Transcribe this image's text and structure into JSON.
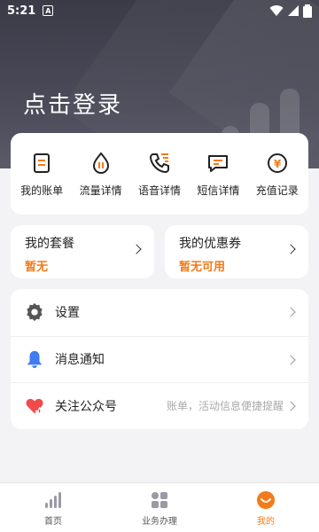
{
  "status_bar": {
    "time": "5:21",
    "notification_letter": "A"
  },
  "header": {
    "login_text": "点击登录"
  },
  "quick_actions": [
    {
      "label": "我的账单",
      "icon": "bill-icon"
    },
    {
      "label": "流量详情",
      "icon": "data-drop-icon"
    },
    {
      "label": "语音详情",
      "icon": "phone-call-icon"
    },
    {
      "label": "短信详情",
      "icon": "message-icon"
    },
    {
      "label": "充值记录",
      "icon": "yen-coin-icon"
    }
  ],
  "cards": {
    "plan": {
      "title": "我的套餐",
      "value": "暂无"
    },
    "coupon": {
      "title": "我的优惠券",
      "value": "暂无可用"
    }
  },
  "menu": [
    {
      "label": "设置",
      "icon": "gear-icon",
      "hint": ""
    },
    {
      "label": "消息通知",
      "icon": "bell-icon",
      "hint": ""
    },
    {
      "label": "关注公众号",
      "icon": "heart-icon",
      "hint": "账单，活动信息便捷提醒"
    }
  ],
  "tabs": [
    {
      "label": "首页",
      "icon": "bar-chart-icon",
      "active": false
    },
    {
      "label": "业务办理",
      "icon": "grid-icon",
      "active": false
    },
    {
      "label": "我的",
      "icon": "smile-icon",
      "active": true
    }
  ],
  "colors": {
    "accent": "#f27b1a",
    "header_dark": "#3b3b48",
    "bell_blue": "#3d7cf2",
    "heart_red": "#f04a4a"
  }
}
